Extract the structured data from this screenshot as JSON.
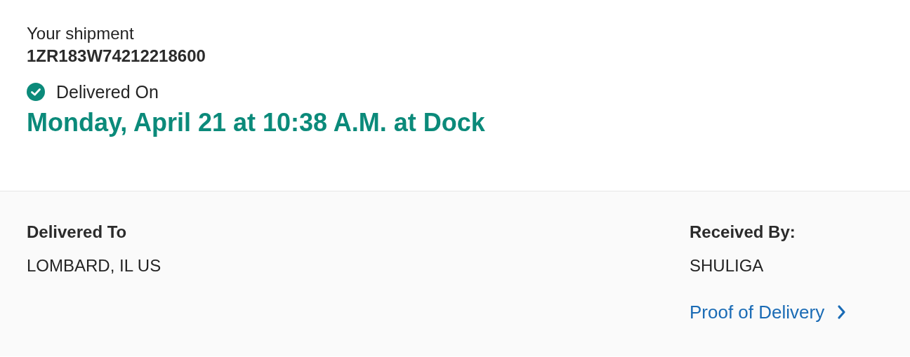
{
  "shipment": {
    "label": "Your shipment",
    "tracking_number": "1ZR183W74212218600"
  },
  "status": {
    "kind": "delivered",
    "label": "Delivered On",
    "datetime": "Monday, April 21 at 10:38 A.M. at Dock"
  },
  "delivered_to": {
    "label": "Delivered To",
    "value": "LOMBARD, IL US"
  },
  "received_by": {
    "label": "Received By:",
    "value": "SHULIGA"
  },
  "proof_link": {
    "label": "Proof of Delivery"
  }
}
